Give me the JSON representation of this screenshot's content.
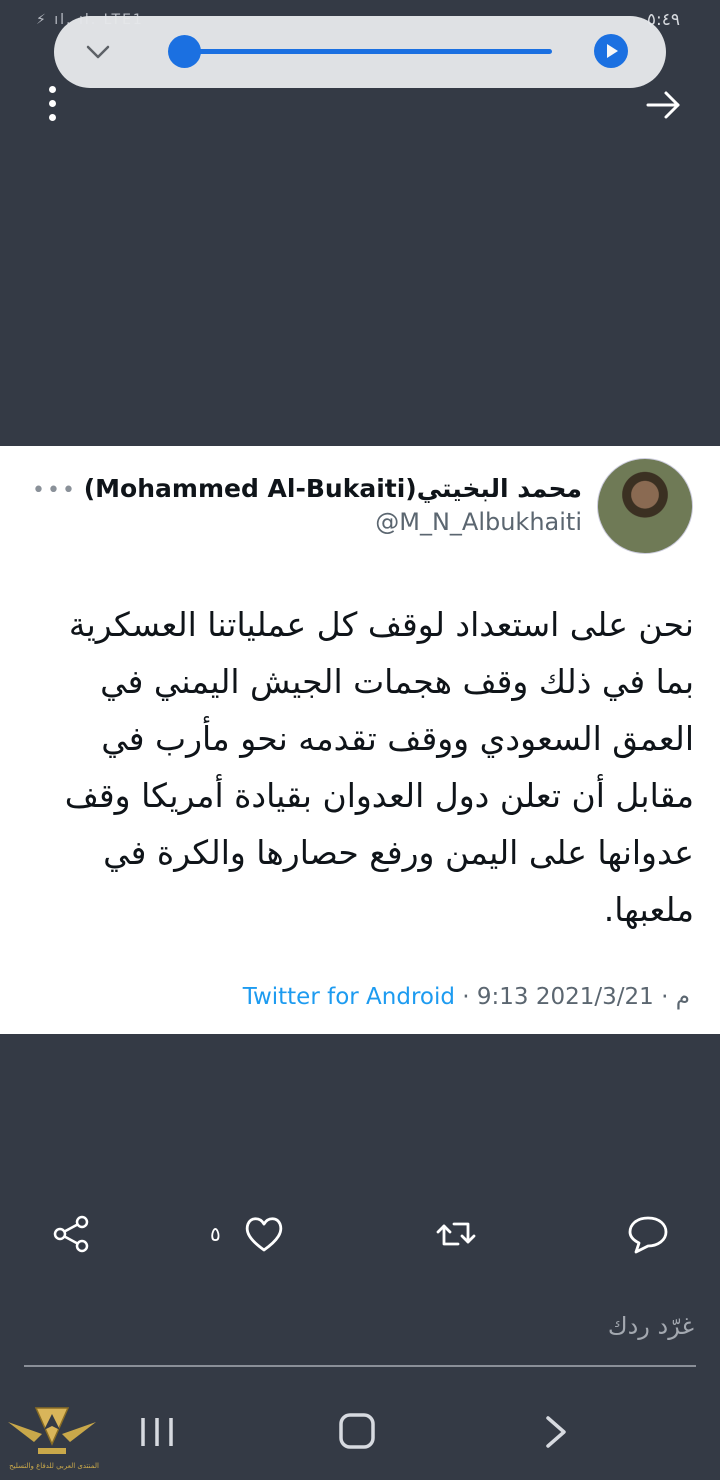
{
  "status_bar": {
    "icons_text": "⚡ ıl. ıl. LTE1",
    "time": "٥:٤٩"
  },
  "media_controls": {
    "collapse_icon": "chevron-down-icon",
    "play_icon": "play-icon",
    "progress": 0.0
  },
  "overlay": {
    "menu_icon": "kebab-menu-icon",
    "share_icon": "forward-arrow-icon"
  },
  "tweet": {
    "display_name": "محمد البخيتي(Mohammed Al-Bukaiti)",
    "handle": "@M_N_Albukhaiti",
    "more_icon": "•••",
    "text": "نحن على استعداد لوقف كل عملياتنا العسكرية بما في ذلك وقف هجمات الجيش اليمني في العمق السعودي ووقف تقدمه نحو مأرب في مقابل أن تعلن دول العدوان بقيادة أمريكا وقف عدوانها على اليمن ورفع حصارها والكرة في ملعبها.",
    "date": "2021/3/21",
    "time": "9:13 م",
    "separator": "·",
    "source": "Twitter for Android"
  },
  "actions": {
    "like_count": "٥"
  },
  "reply": {
    "placeholder": "غرّد ردك"
  },
  "watermark": {
    "caption": "المنتدى العربي للدفاع والتسليح"
  },
  "colors": {
    "background": "#343a45",
    "accent": "#1a73e8",
    "link": "#1d9bf0"
  }
}
